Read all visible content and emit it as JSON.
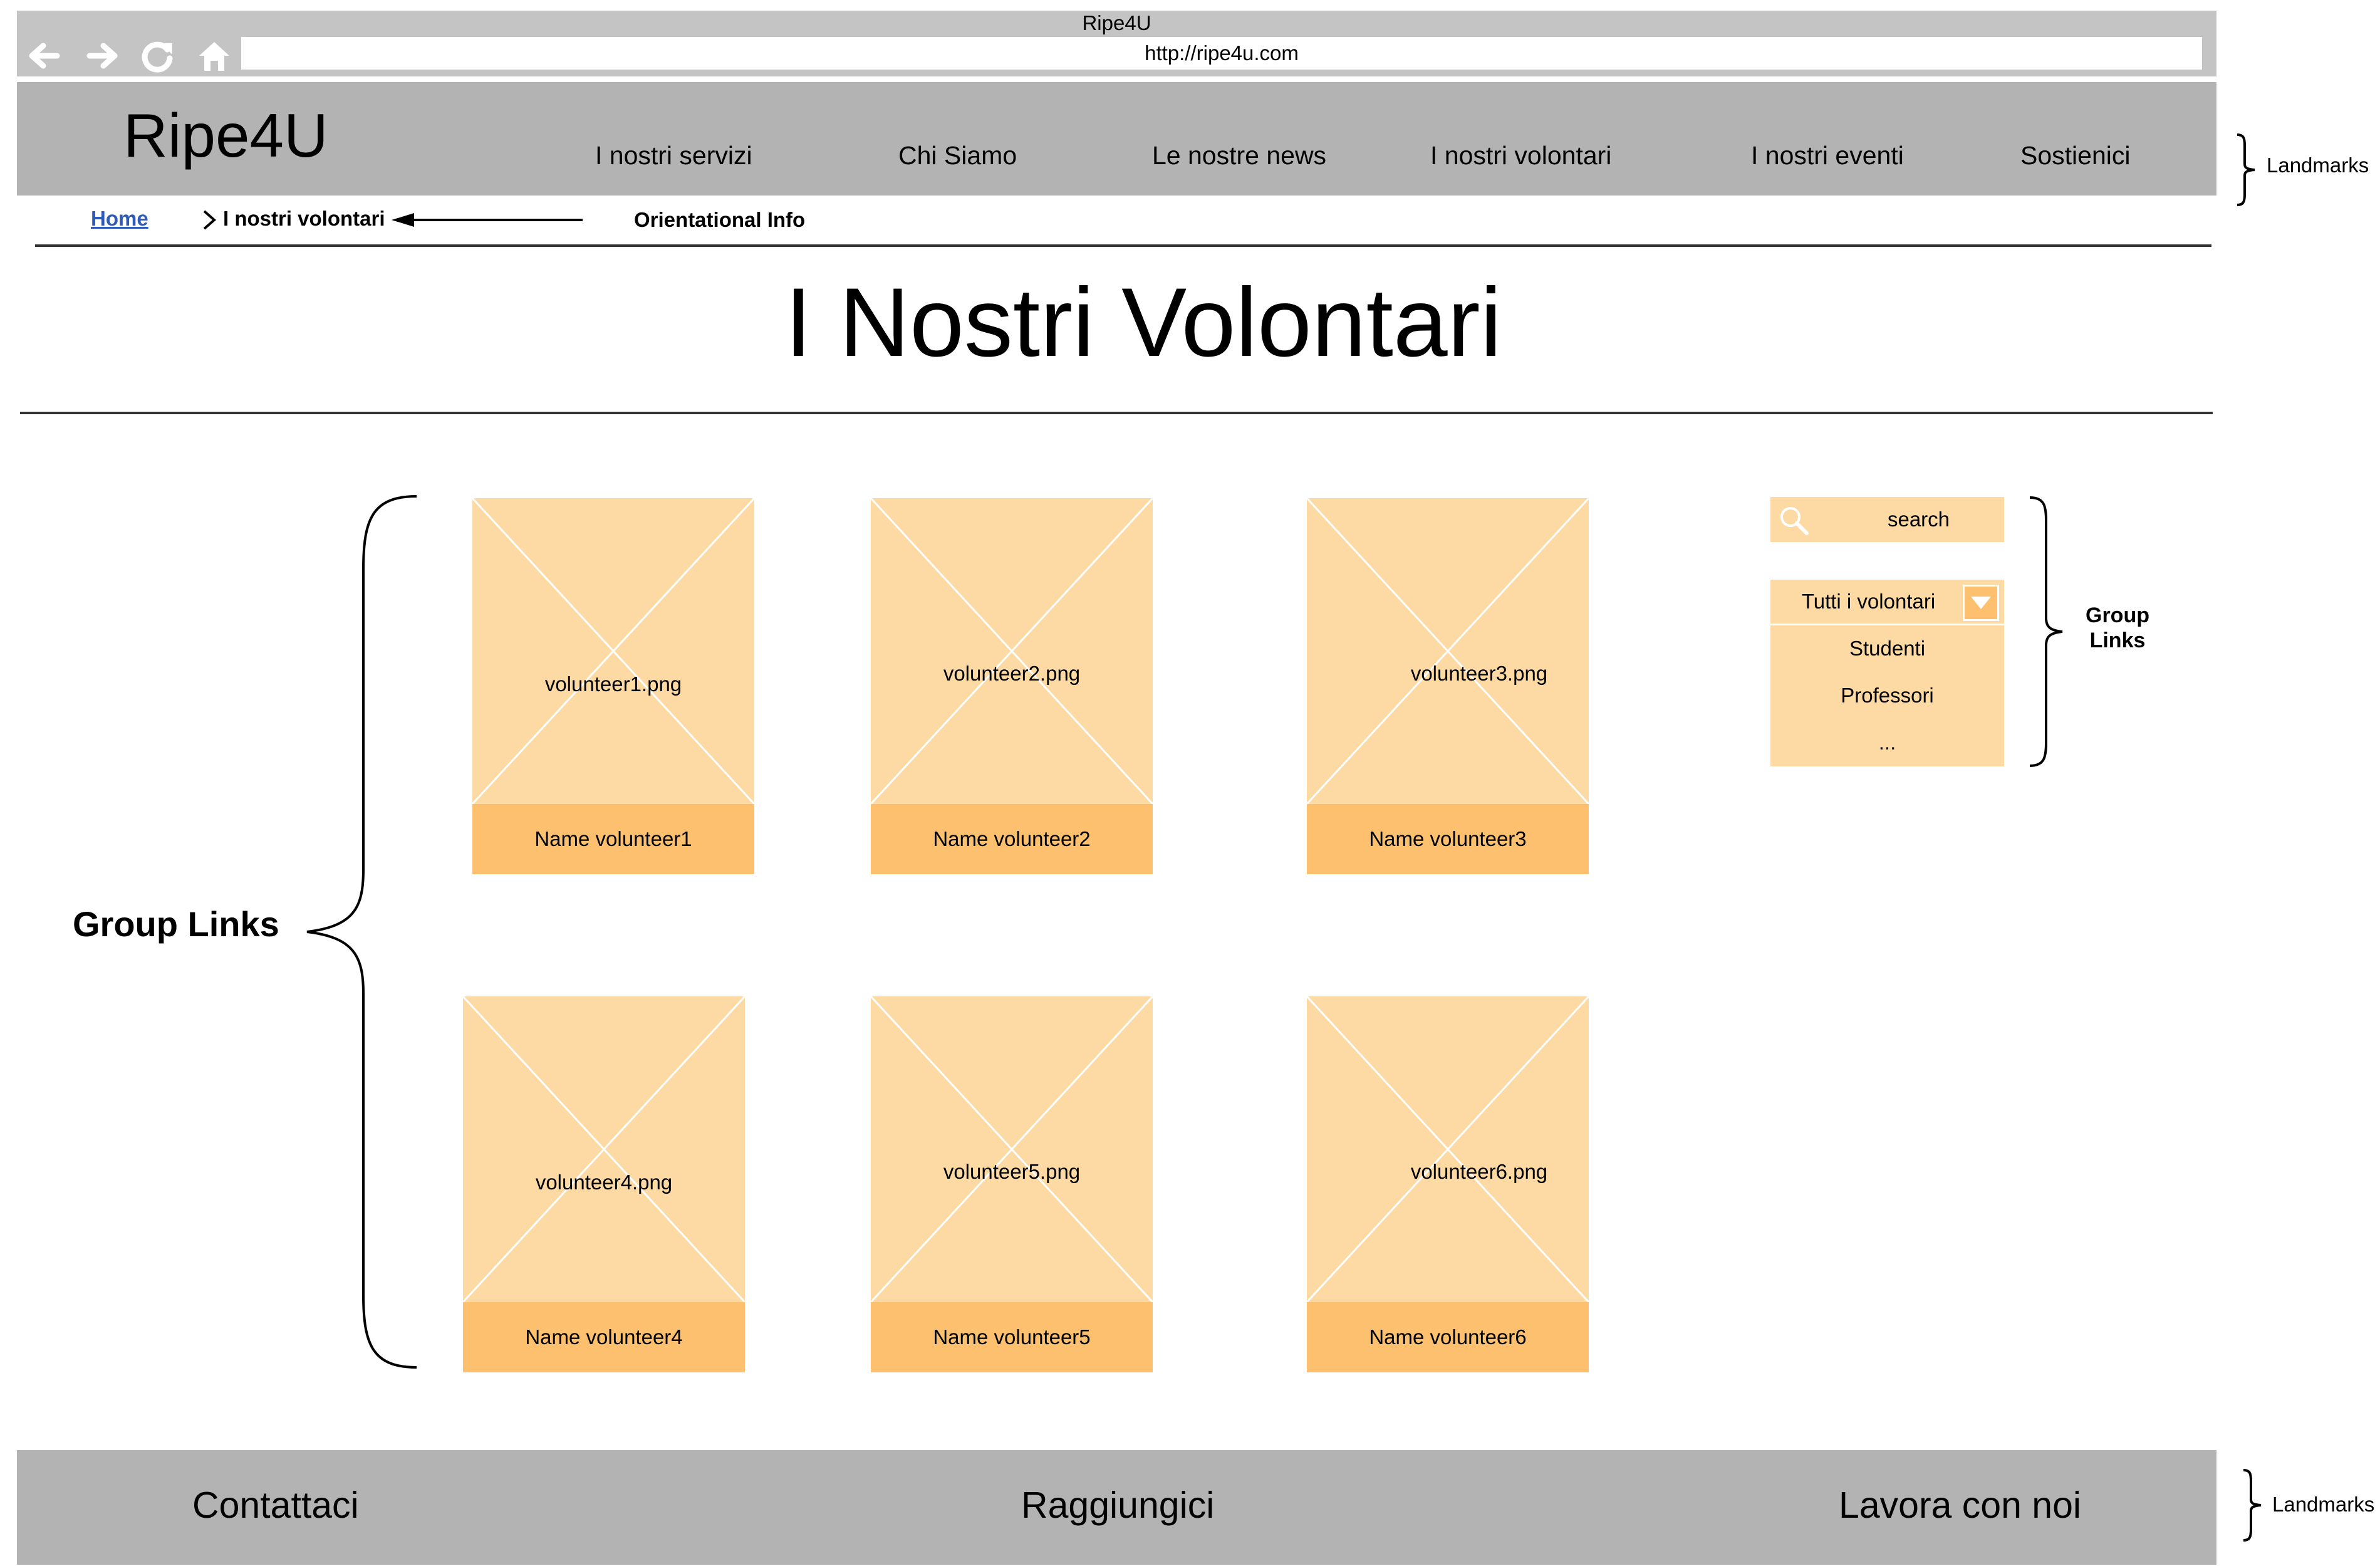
{
  "browser": {
    "window_title": "Ripe4U",
    "address_url": "http://ripe4u.com",
    "icons": [
      "back-arrow-icon",
      "forward-arrow-icon",
      "reload-icon",
      "home-icon"
    ]
  },
  "header": {
    "logo": "Ripe4U",
    "nav": [
      {
        "label": "I nostri servizi"
      },
      {
        "label": "Chi Siamo"
      },
      {
        "label": "Le nostre news"
      },
      {
        "label": "I nostri volontari"
      },
      {
        "label": "I nostri eventi"
      },
      {
        "label": "Sostienici"
      }
    ]
  },
  "breadcrumb": {
    "home": "Home",
    "current": "I nostri volontari"
  },
  "page_title": "I Nostri Volontari",
  "volunteers": [
    {
      "image": "volunteer1.png",
      "name": "Name volunteer1"
    },
    {
      "image": "volunteer2.png",
      "name": "Name volunteer2"
    },
    {
      "image": "volunteer3.png",
      "name": "Name volunteer3"
    },
    {
      "image": "volunteer4.png",
      "name": "Name volunteer4"
    },
    {
      "image": "volunteer5.png",
      "name": "Name volunteer5"
    },
    {
      "image": "volunteer6.png",
      "name": "Name volunteer6"
    }
  ],
  "sidebar": {
    "search_label": "search",
    "search_icon": "magnifier-icon",
    "filter_selected": "Tutti i volontari",
    "filter_options": [
      "Studenti",
      "Professori",
      "..."
    ]
  },
  "footer": {
    "links": [
      {
        "label": "Contattaci"
      },
      {
        "label": "Raggiungici"
      },
      {
        "label": "Lavora con noi"
      }
    ]
  },
  "annotations": {
    "landmarks_header": "Landmarks",
    "orientational_info": "Orientational Info",
    "group_links_main": "Group Links",
    "group_links_side": "Group Links",
    "landmarks_footer": "Landmarks"
  },
  "colors": {
    "chrome": "#c4c4c4",
    "header_bg": "#b3b3b3",
    "card_image_bg": "#fdd9a4",
    "card_name_bg": "#fcc06f",
    "link": "#2e5bb8"
  }
}
